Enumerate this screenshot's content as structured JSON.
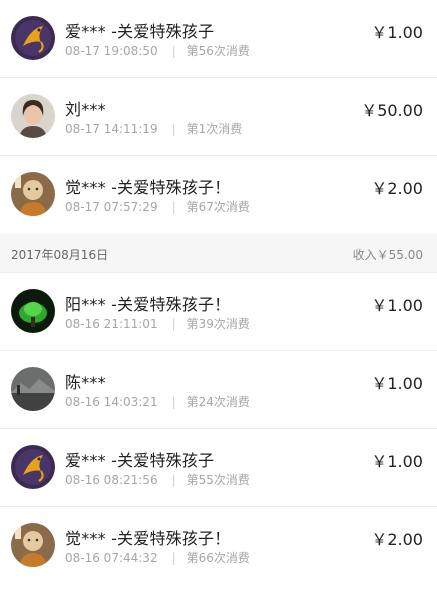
{
  "group1": {
    "rows": [
      {
        "name": "爱*** -关爱特殊孩子",
        "time": "08-17 19:08:50",
        "count": "第56次消费",
        "amount": "￥1.00",
        "avatar": "fish-avatar-icon"
      },
      {
        "name": "刘***",
        "time": "08-17 14:11:19",
        "count": "第1次消费",
        "amount": "￥50.00",
        "avatar": "woman-avatar-icon"
      },
      {
        "name": "觉*** -关爱特殊孩子！",
        "time": "08-17 07:57:29",
        "count": "第67次消费",
        "amount": "￥2.00",
        "avatar": "monk-avatar-icon"
      }
    ]
  },
  "group2": {
    "date": "2017年08月16日",
    "income": "收入￥55.00",
    "rows": [
      {
        "name": "阳*** -关爱特殊孩子！",
        "time": "08-16 21:11:01",
        "count": "第39次消费",
        "amount": "￥1.00",
        "avatar": "green-jade-avatar-icon"
      },
      {
        "name": "陈***",
        "time": "08-16 14:03:21",
        "count": "第24次消费",
        "amount": "￥1.00",
        "avatar": "landscape-avatar-icon"
      },
      {
        "name": "爱*** -关爱特殊孩子",
        "time": "08-16 08:21:56",
        "count": "第55次消费",
        "amount": "￥1.00",
        "avatar": "fish-avatar-icon"
      },
      {
        "name": "觉*** -关爱特殊孩子！",
        "time": "08-16 07:44:32",
        "count": "第66次消费",
        "amount": "￥2.00",
        "avatar": "monk-avatar-icon"
      }
    ]
  }
}
